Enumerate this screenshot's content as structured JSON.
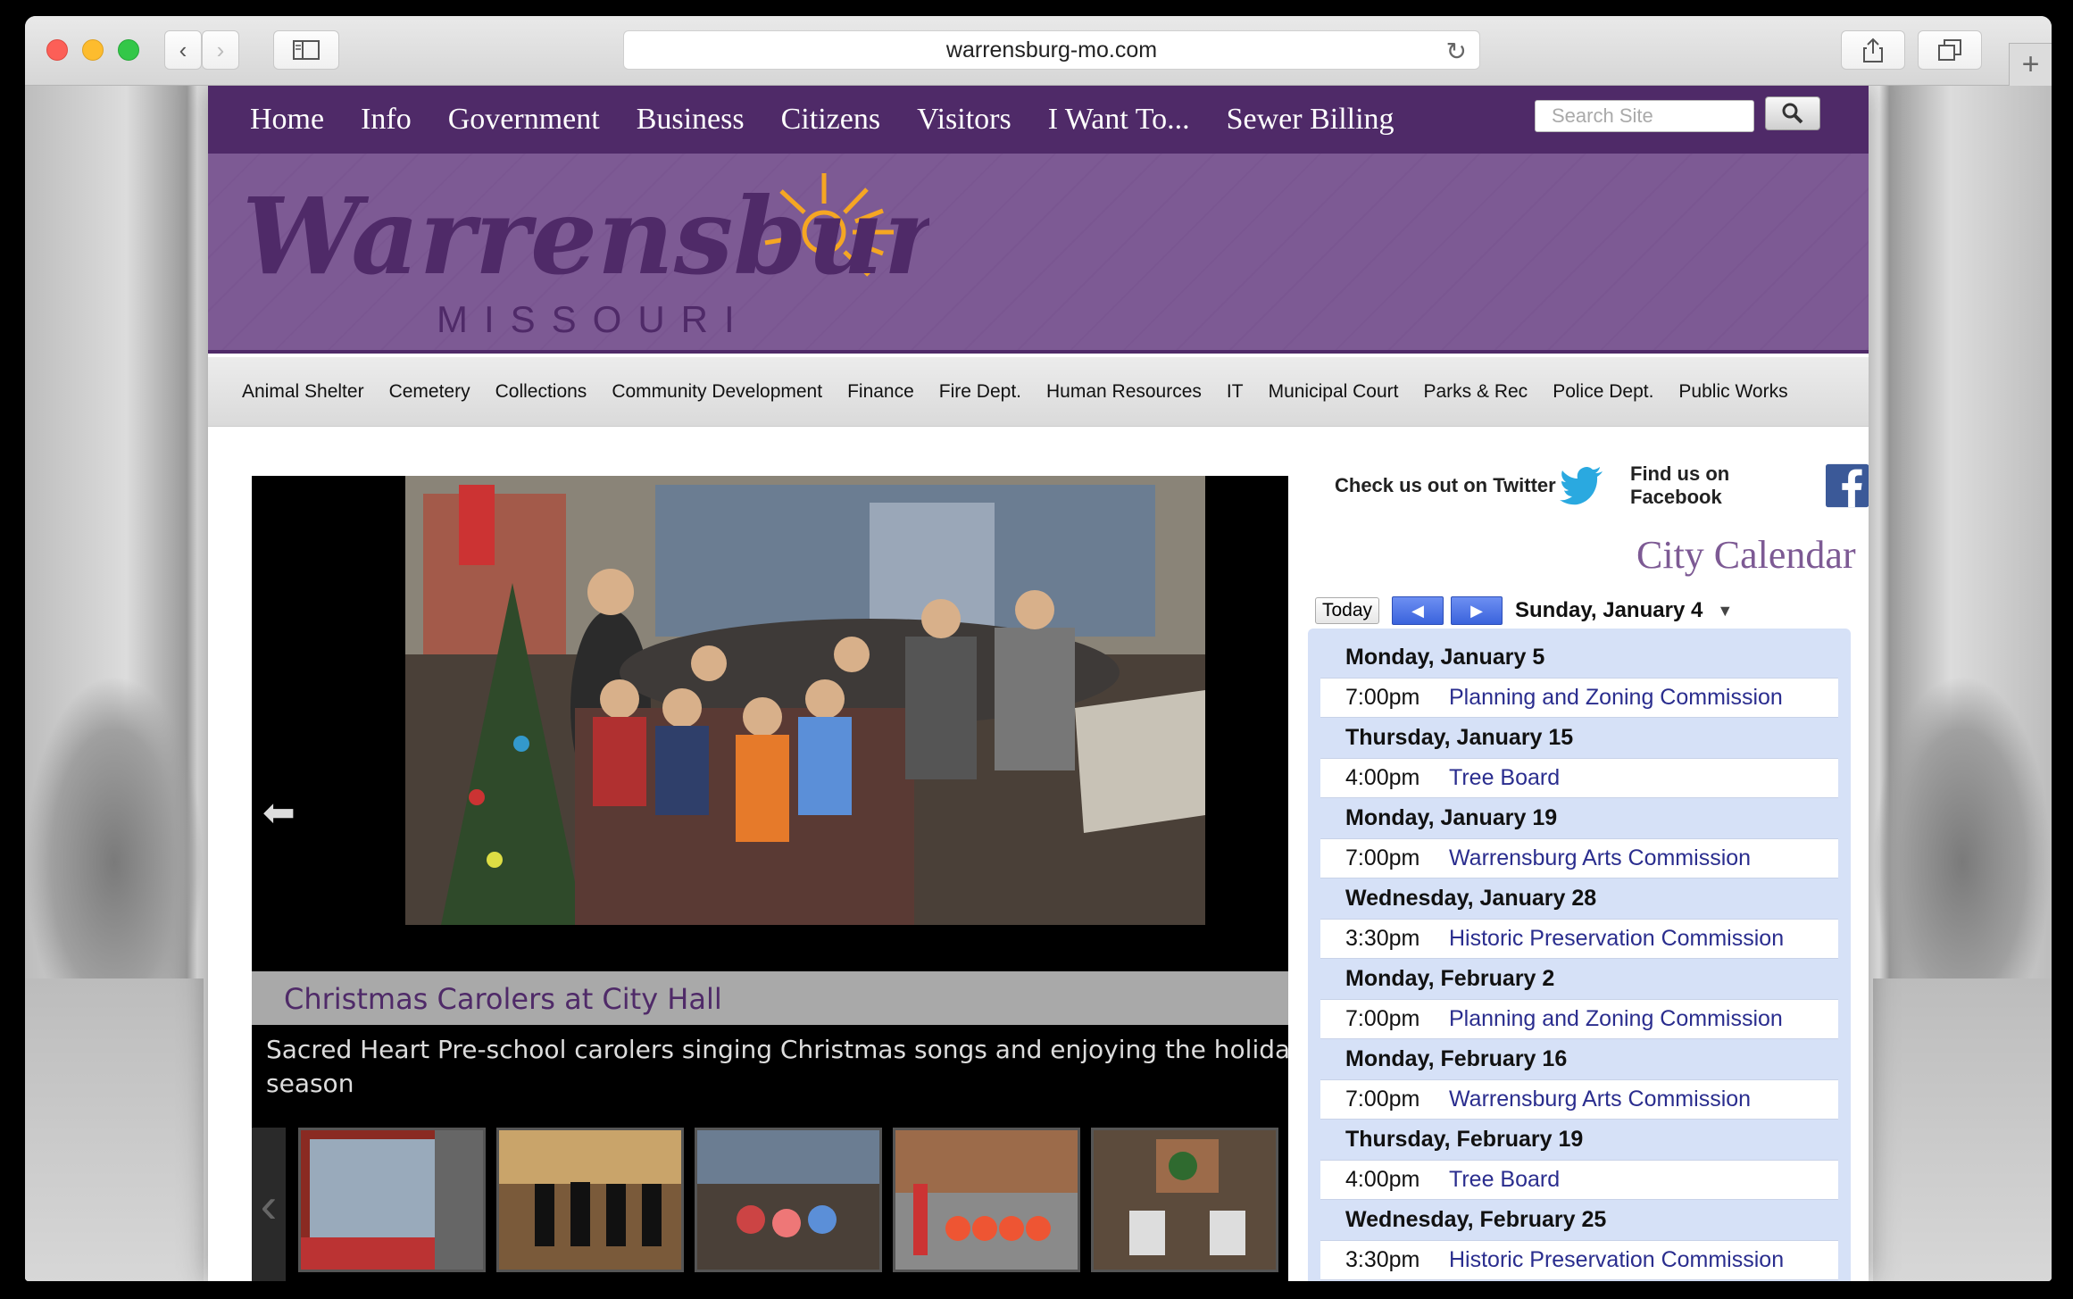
{
  "browser": {
    "url": "warrensburg-mo.com"
  },
  "nav": {
    "items": [
      "Home",
      "Info",
      "Government",
      "Business",
      "Citizens",
      "Visitors",
      "I Want To...",
      "Sewer Billing"
    ],
    "search_placeholder": "Search Site"
  },
  "logo": {
    "wordmark": "Warrensburg",
    "state": "MISSOURI"
  },
  "departments": [
    "Animal Shelter",
    "Cemetery",
    "Collections",
    "Community Development",
    "Finance",
    "Fire Dept.",
    "Human Resources",
    "IT",
    "Municipal Court",
    "Parks & Rec",
    "Police Dept.",
    "Public Works"
  ],
  "slideshow": {
    "title": "Christmas Carolers at City Hall",
    "description_line1": "Sacred Heart Pre-school carolers singing Christmas songs and enjoying the holida",
    "description_line2": "season"
  },
  "social": {
    "twitter": "Check us out on Twitter",
    "facebook": "Find us on Facebook"
  },
  "calendar": {
    "title": "City Calendar",
    "today_label": "Today",
    "current_date": "Sunday, January 4",
    "days": [
      {
        "date": "Monday, January 5",
        "time": "7:00pm",
        "event": "Planning and Zoning Commission"
      },
      {
        "date": "Thursday, January 15",
        "time": "4:00pm",
        "event": "Tree Board"
      },
      {
        "date": "Monday, January 19",
        "time": "7:00pm",
        "event": "Warrensburg Arts Commission"
      },
      {
        "date": "Wednesday, January 28",
        "time": "3:30pm",
        "event": "Historic Preservation Commission"
      },
      {
        "date": "Monday, February 2",
        "time": "7:00pm",
        "event": "Planning and Zoning Commission"
      },
      {
        "date": "Monday, February 16",
        "time": "7:00pm",
        "event": "Warrensburg Arts Commission"
      },
      {
        "date": "Thursday, February 19",
        "time": "4:00pm",
        "event": "Tree Board"
      },
      {
        "date": "Wednesday, February 25",
        "time": "3:30pm",
        "event": "Historic Preservation Commission"
      }
    ]
  },
  "colors": {
    "brand_purple": "#4f2a68",
    "banner_purple": "#7d5a94",
    "calendar_bg": "#d6e1f7",
    "event_link": "#2a2d8e",
    "sun_orange": "#f5a623"
  }
}
